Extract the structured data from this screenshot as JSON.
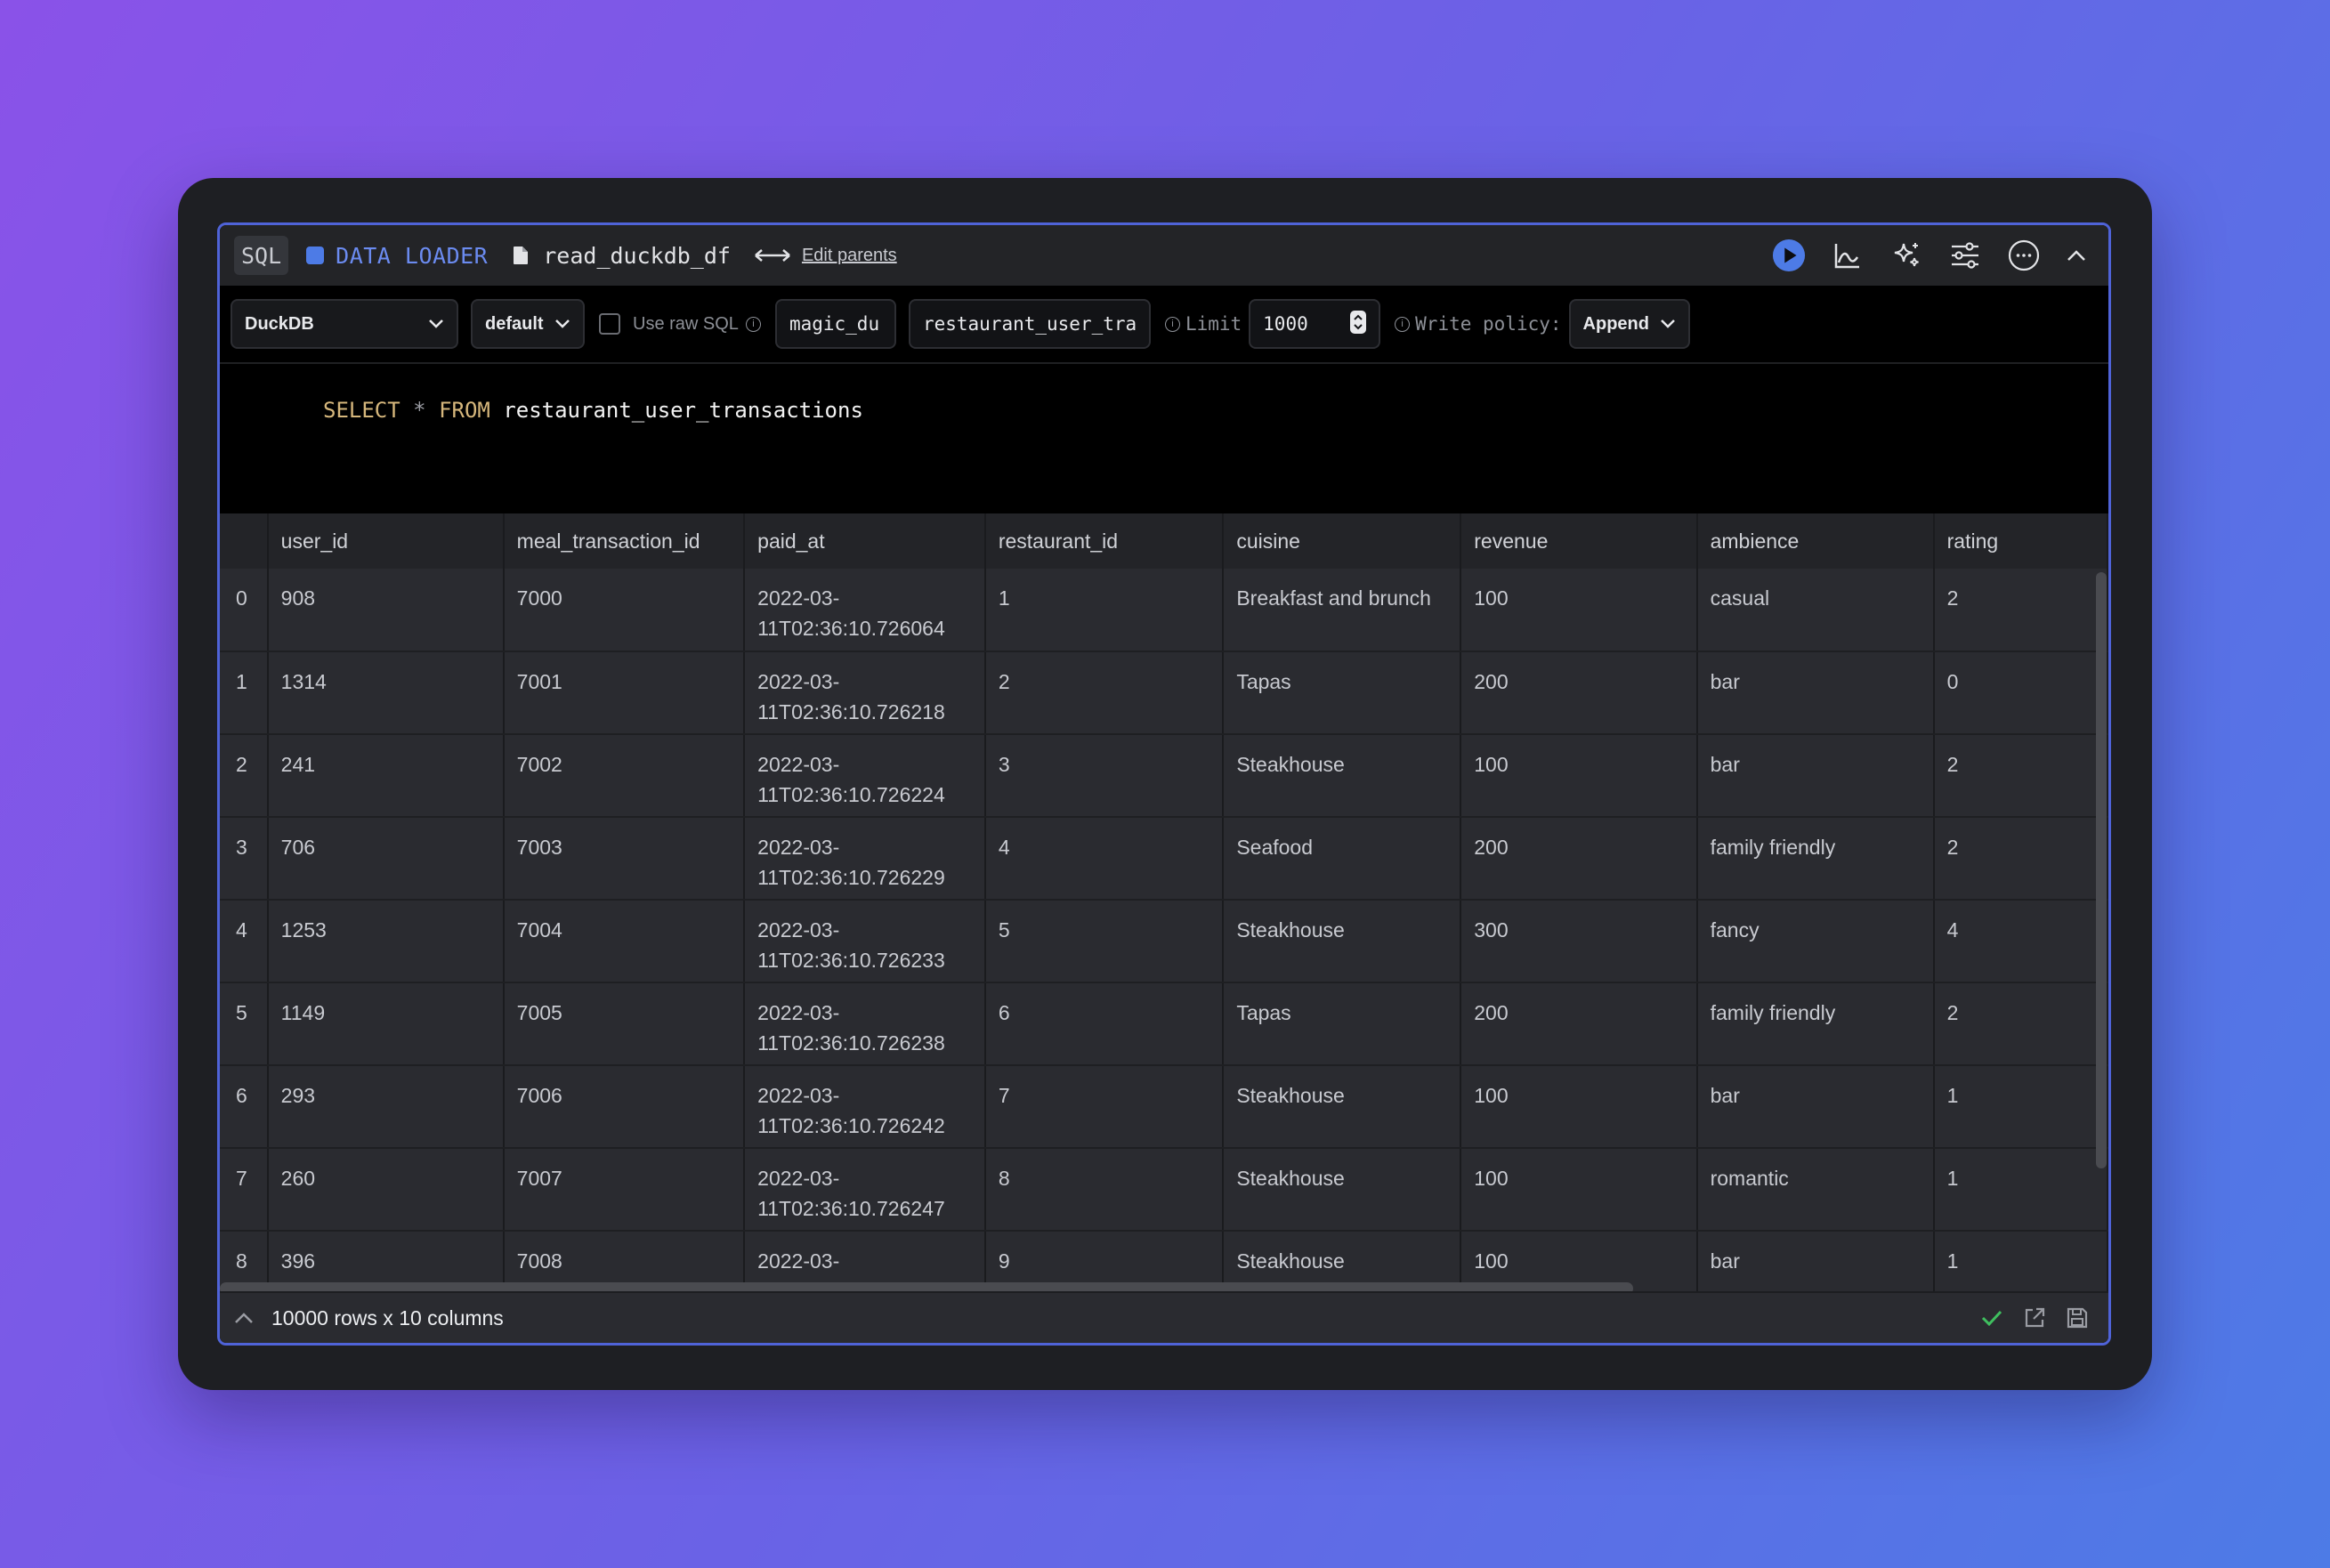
{
  "header": {
    "language_badge": "SQL",
    "block_type": "DATA LOADER",
    "block_name": "read_duckdb_df",
    "edit_parents": "Edit parents"
  },
  "toolbar": {
    "connection": "DuckDB",
    "profile": "default",
    "raw_sql_label": "Use raw SQL",
    "raw_sql_checked": false,
    "schema": "magic_du",
    "table": "restaurant_user_tra",
    "limit_label": "Limit",
    "limit_value": "1000",
    "write_policy_label": "Write policy:",
    "write_policy": "Append"
  },
  "editor": {
    "select": "SELECT",
    "star": "*",
    "from": "FROM",
    "table": "restaurant_user_transactions"
  },
  "table": {
    "columns": [
      "user_id",
      "meal_transaction_id",
      "paid_at",
      "restaurant_id",
      "cuisine",
      "revenue",
      "ambience",
      "rating"
    ],
    "rows": [
      {
        "idx": "0",
        "user_id": "908",
        "meal_transaction_id": "7000",
        "paid_at_1": "2022-03-",
        "paid_at_2": "11T02:36:10.726064",
        "restaurant_id": "1",
        "cuisine": "Breakfast and brunch",
        "revenue": "100",
        "ambience": "casual",
        "rating": "2"
      },
      {
        "idx": "1",
        "user_id": "1314",
        "meal_transaction_id": "7001",
        "paid_at_1": "2022-03-",
        "paid_at_2": "11T02:36:10.726218",
        "restaurant_id": "2",
        "cuisine": "Tapas",
        "revenue": "200",
        "ambience": "bar",
        "rating": "0"
      },
      {
        "idx": "2",
        "user_id": "241",
        "meal_transaction_id": "7002",
        "paid_at_1": "2022-03-",
        "paid_at_2": "11T02:36:10.726224",
        "restaurant_id": "3",
        "cuisine": "Steakhouse",
        "revenue": "100",
        "ambience": "bar",
        "rating": "2"
      },
      {
        "idx": "3",
        "user_id": "706",
        "meal_transaction_id": "7003",
        "paid_at_1": "2022-03-",
        "paid_at_2": "11T02:36:10.726229",
        "restaurant_id": "4",
        "cuisine": "Seafood",
        "revenue": "200",
        "ambience": "family friendly",
        "rating": "2"
      },
      {
        "idx": "4",
        "user_id": "1253",
        "meal_transaction_id": "7004",
        "paid_at_1": "2022-03-",
        "paid_at_2": "11T02:36:10.726233",
        "restaurant_id": "5",
        "cuisine": "Steakhouse",
        "revenue": "300",
        "ambience": "fancy",
        "rating": "4"
      },
      {
        "idx": "5",
        "user_id": "1149",
        "meal_transaction_id": "7005",
        "paid_at_1": "2022-03-",
        "paid_at_2": "11T02:36:10.726238",
        "restaurant_id": "6",
        "cuisine": "Tapas",
        "revenue": "200",
        "ambience": "family friendly",
        "rating": "2"
      },
      {
        "idx": "6",
        "user_id": "293",
        "meal_transaction_id": "7006",
        "paid_at_1": "2022-03-",
        "paid_at_2": "11T02:36:10.726242",
        "restaurant_id": "7",
        "cuisine": "Steakhouse",
        "revenue": "100",
        "ambience": "bar",
        "rating": "1"
      },
      {
        "idx": "7",
        "user_id": "260",
        "meal_transaction_id": "7007",
        "paid_at_1": "2022-03-",
        "paid_at_2": "11T02:36:10.726247",
        "restaurant_id": "8",
        "cuisine": "Steakhouse",
        "revenue": "100",
        "ambience": "romantic",
        "rating": "1"
      },
      {
        "idx": "8",
        "user_id": "396",
        "meal_transaction_id": "7008",
        "paid_at_1": "2022-03-",
        "paid_at_2": "",
        "restaurant_id": "9",
        "cuisine": "Steakhouse",
        "revenue": "100",
        "ambience": "bar",
        "rating": "1"
      }
    ]
  },
  "footer": {
    "summary": "10000 rows x 10 columns"
  },
  "colors": {
    "accent": "#4d7be6",
    "success": "#3fbf5f",
    "keyword": "#d6b77c"
  }
}
